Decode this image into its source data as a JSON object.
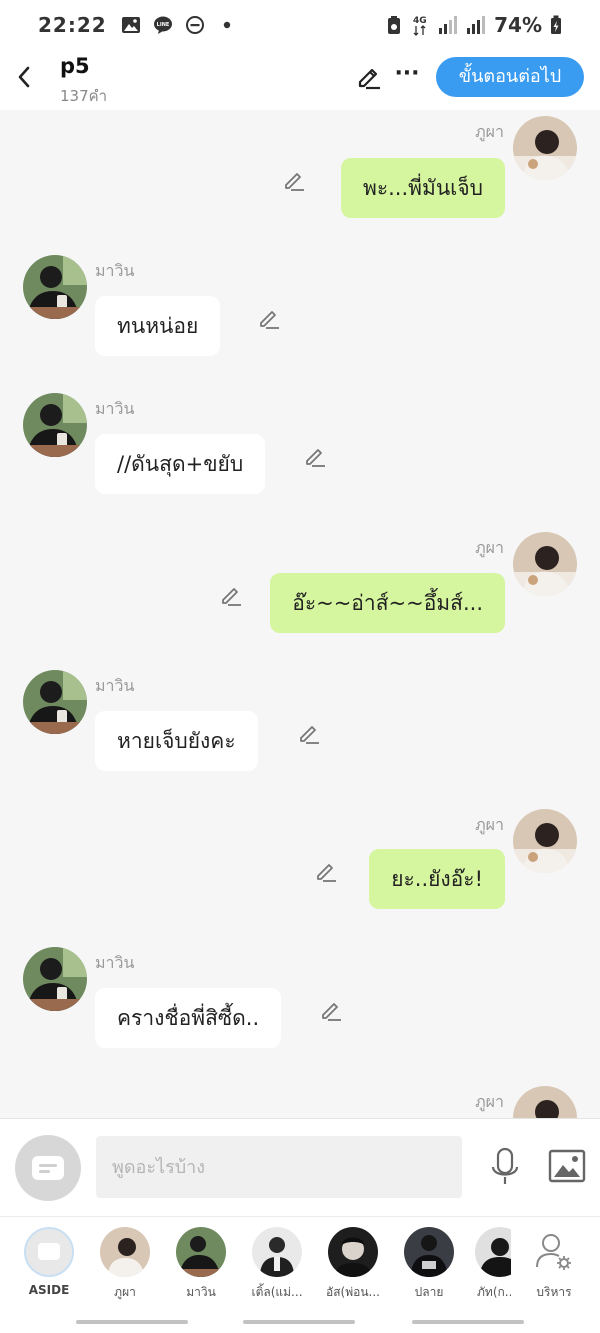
{
  "status": {
    "time": "22:22",
    "network": "4G",
    "battery": "74%"
  },
  "header": {
    "title": "p5",
    "word_count": "137คำ",
    "next_label": "ขั้นตอนต่อไป"
  },
  "messages": [
    {
      "side": "right",
      "sender": "ภูผา",
      "text": "พะ...พี่มันเจ็บ"
    },
    {
      "side": "left",
      "sender": "มาวิน",
      "text": "ทนหน่อย"
    },
    {
      "side": "left",
      "sender": "มาวิน",
      "text": "//ดันสุด+ขยับ"
    },
    {
      "side": "right",
      "sender": "ภูผา",
      "text": "อ๊ะ~~อ่าส์~~อึ้มส์..."
    },
    {
      "side": "left",
      "sender": "มาวิน",
      "text": "หายเจ็บยังคะ"
    },
    {
      "side": "right",
      "sender": "ภูผา",
      "text": "ยะ..ยังอ๊ะ!"
    },
    {
      "side": "left",
      "sender": "มาวิน",
      "text": "ครางชื่อพี่สิซี้ด.."
    },
    {
      "side": "right",
      "sender": "ภูผา",
      "text": ""
    }
  ],
  "input": {
    "placeholder": "พูดอะไรบ้าง"
  },
  "characters": [
    {
      "label": "ASIDE"
    },
    {
      "label": "ภูผา"
    },
    {
      "label": "มาวิน"
    },
    {
      "label": "เติ้ล(แม่..."
    },
    {
      "label": "อัส(พ่อน..."
    },
    {
      "label": "ปลาย"
    },
    {
      "label": "ภัท(ก..."
    },
    {
      "label": "บริหาร"
    }
  ],
  "colors": {
    "accent_blue": "#3a9cf1",
    "right_bubble": "#d5f59e",
    "left_bubble": "#ffffff",
    "background": "#f6f6f6"
  }
}
